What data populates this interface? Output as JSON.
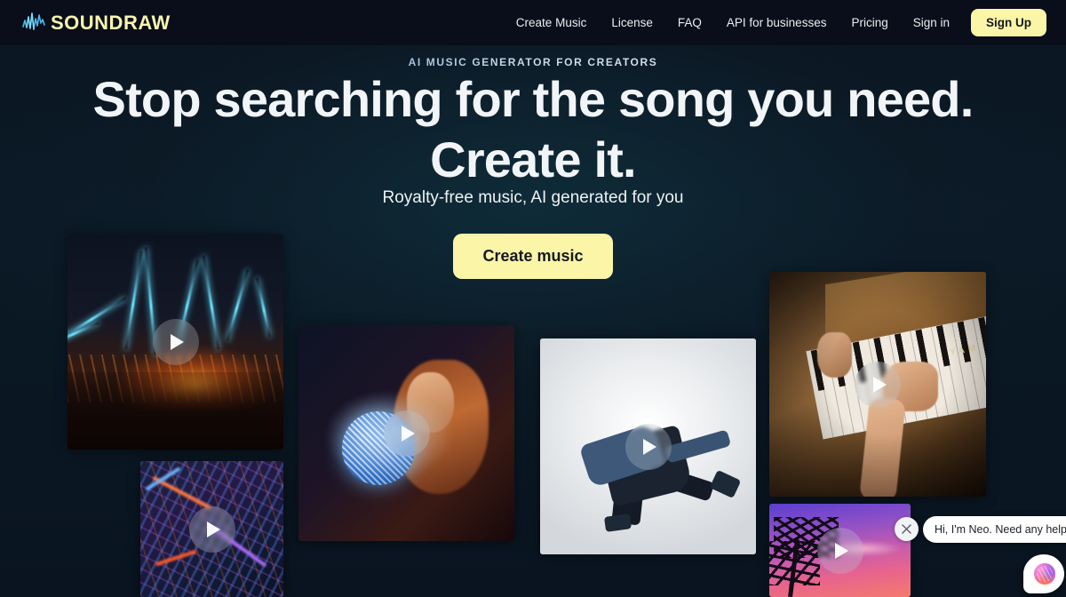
{
  "brand": {
    "name": "SOUNDRAW",
    "logo_icon": "waveform-icon",
    "logo_color": "#f7f5b0",
    "wave_color": "#4fb8e8"
  },
  "header": {
    "nav_items": [
      {
        "label": "Create Music",
        "name": "nav-create-music"
      },
      {
        "label": "License",
        "name": "nav-license"
      },
      {
        "label": "FAQ",
        "name": "nav-faq"
      },
      {
        "label": "API for businesses",
        "name": "nav-api-for-businesses"
      },
      {
        "label": "Pricing",
        "name": "nav-pricing"
      },
      {
        "label": "Sign in",
        "name": "nav-sign-in"
      }
    ],
    "signup_label": "Sign Up",
    "signup_bg": "#fbf5a8",
    "background": "#0a0e1a"
  },
  "hero": {
    "eyebrow": "AI MUSIC GENERATOR FOR CREATORS",
    "headline_line1": "Stop searching for the song you need.",
    "headline_line2": "Create it.",
    "subhead": "Royalty-free music, AI generated for you",
    "cta_label": "Create music",
    "cta_bg": "#fbf5a8",
    "cta_text_color": "#15191f"
  },
  "gallery": {
    "play_icon": "play-icon",
    "cards": [
      {
        "name": "card-concert",
        "alt": "Concert stage with cyan light beams over a crowd"
      },
      {
        "name": "card-city",
        "alt": "Aerial night view of a neon-lit city"
      },
      {
        "name": "card-disco",
        "alt": "Woman with a mirror disco ball"
      },
      {
        "name": "card-dancer",
        "alt": "Breakdancer mid-move on a white background"
      },
      {
        "name": "card-piano",
        "alt": "Hands playing a wooden Yamaha upright piano"
      },
      {
        "name": "card-tropical",
        "alt": "Palm trees against a purple and pink sunset"
      }
    ],
    "piano_brand_text": "YAM"
  },
  "chat": {
    "message": "Hi, I'm Neo. Need any help?",
    "close_icon": "close-icon",
    "avatar_icon": "neo-avatar-icon"
  }
}
